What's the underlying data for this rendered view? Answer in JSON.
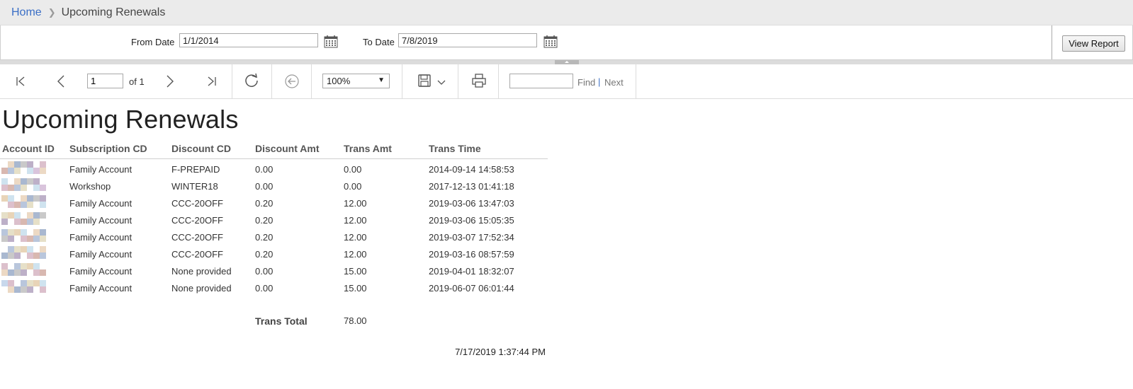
{
  "breadcrumb": {
    "home": "Home",
    "current": "Upcoming Renewals"
  },
  "params": {
    "from_label": "From Date",
    "from_value": "1/1/2014",
    "to_label": "To Date",
    "to_value": "7/8/2019",
    "view_report_label": "View Report"
  },
  "toolbar": {
    "page_value": "1",
    "of_label": "of 1",
    "zoom_value": "100%",
    "find_label": "Find",
    "separator": "|",
    "next_label": "Next"
  },
  "report": {
    "title": "Upcoming Renewals",
    "columns": [
      "Account ID",
      "Subscription CD",
      "Discount CD",
      "Discount Amt",
      "Trans Amt",
      "Trans Time"
    ],
    "rows": [
      {
        "subscription": "Family Account",
        "discount_cd": "F-PREPAID",
        "discount_amt": "0.00",
        "trans_amt": "0.00",
        "trans_time": "2014-09-14 14:58:53"
      },
      {
        "subscription": "Workshop",
        "discount_cd": "WINTER18",
        "discount_amt": "0.00",
        "trans_amt": "0.00",
        "trans_time": "2017-12-13 01:41:18"
      },
      {
        "subscription": "Family Account",
        "discount_cd": "CCC-20OFF",
        "discount_amt": "0.20",
        "trans_amt": "12.00",
        "trans_time": "2019-03-06 13:47:03"
      },
      {
        "subscription": "Family Account",
        "discount_cd": "CCC-20OFF",
        "discount_amt": "0.20",
        "trans_amt": "12.00",
        "trans_time": "2019-03-06 15:05:35"
      },
      {
        "subscription": "Family Account",
        "discount_cd": "CCC-20OFF",
        "discount_amt": "0.20",
        "trans_amt": "12.00",
        "trans_time": "2019-03-07 17:52:34"
      },
      {
        "subscription": "Family Account",
        "discount_cd": "CCC-20OFF",
        "discount_amt": "0.20",
        "trans_amt": "12.00",
        "trans_time": "2019-03-16 08:57:59"
      },
      {
        "subscription": "Family Account",
        "discount_cd": "None provided",
        "discount_amt": "0.00",
        "trans_amt": "15.00",
        "trans_time": "2019-04-01 18:32:07"
      },
      {
        "subscription": "Family Account",
        "discount_cd": "None provided",
        "discount_amt": "0.00",
        "trans_amt": "15.00",
        "trans_time": "2019-06-07 06:01:44"
      }
    ],
    "total_label": "Trans Total",
    "total_value": "78.00",
    "generated_at": "7/17/2019 1:37:44 PM"
  },
  "colors": {
    "link": "#3b6fc6",
    "header_bg": "#ebebeb",
    "icon": "#555555"
  },
  "icons": [
    "calendar-icon",
    "first-page-icon",
    "prev-page-icon",
    "next-page-icon",
    "last-page-icon",
    "refresh-icon",
    "back-icon",
    "save-icon",
    "chevron-down-icon",
    "print-icon"
  ]
}
